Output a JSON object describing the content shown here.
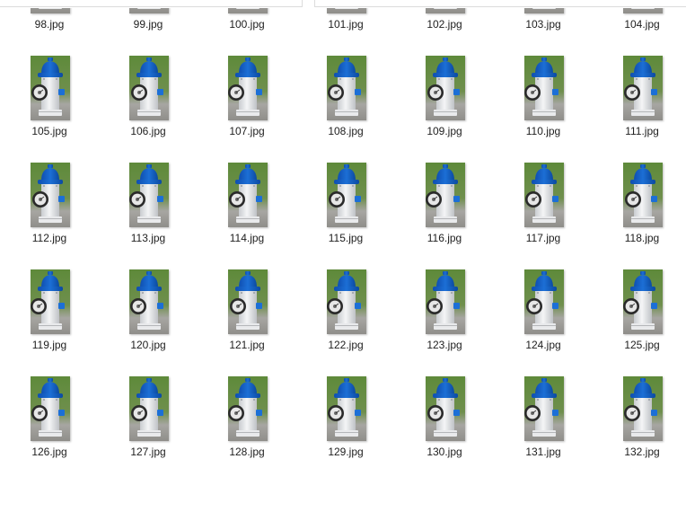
{
  "folder": {
    "view": "large-icons",
    "files": [
      {
        "name": "98.jpg"
      },
      {
        "name": "99.jpg"
      },
      {
        "name": "100.jpg"
      },
      {
        "name": "101.jpg"
      },
      {
        "name": "102.jpg"
      },
      {
        "name": "103.jpg"
      },
      {
        "name": "104.jpg"
      },
      {
        "name": "105.jpg"
      },
      {
        "name": "106.jpg"
      },
      {
        "name": "107.jpg"
      },
      {
        "name": "108.jpg"
      },
      {
        "name": "109.jpg"
      },
      {
        "name": "110.jpg"
      },
      {
        "name": "111.jpg"
      },
      {
        "name": "112.jpg"
      },
      {
        "name": "113.jpg"
      },
      {
        "name": "114.jpg"
      },
      {
        "name": "115.jpg"
      },
      {
        "name": "116.jpg"
      },
      {
        "name": "117.jpg"
      },
      {
        "name": "118.jpg"
      },
      {
        "name": "119.jpg"
      },
      {
        "name": "120.jpg"
      },
      {
        "name": "121.jpg"
      },
      {
        "name": "122.jpg"
      },
      {
        "name": "123.jpg"
      },
      {
        "name": "124.jpg"
      },
      {
        "name": "125.jpg"
      },
      {
        "name": "126.jpg"
      },
      {
        "name": "127.jpg"
      },
      {
        "name": "128.jpg"
      },
      {
        "name": "129.jpg"
      },
      {
        "name": "130.jpg"
      },
      {
        "name": "131.jpg"
      },
      {
        "name": "132.jpg"
      }
    ],
    "thumbnail_icon": "fire-hydrant-photo-icon",
    "colors": {
      "hydrant_cap": "#1c6fd6",
      "hydrant_body": "#f4f5f6",
      "gauge_ring": "#2a2a2a",
      "grass": "#5e8a3a",
      "pavement": "#a7a6a2"
    }
  }
}
